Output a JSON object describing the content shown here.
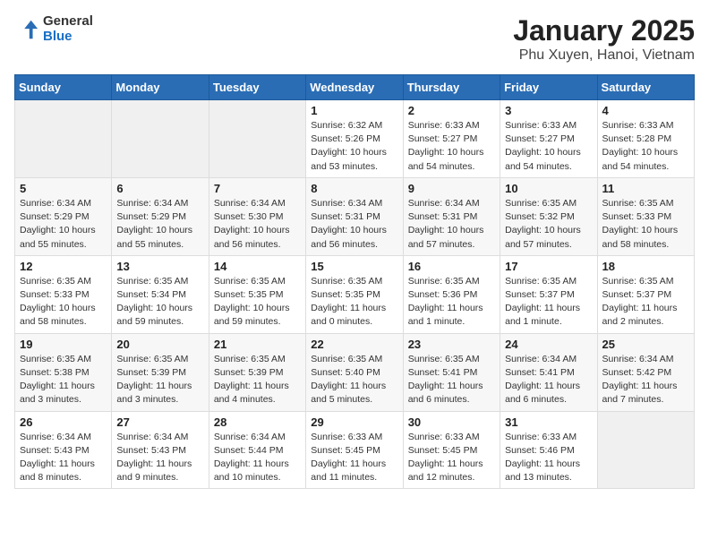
{
  "header": {
    "logo_line1": "General",
    "logo_line2": "Blue",
    "title": "January 2025",
    "subtitle": "Phu Xuyen, Hanoi, Vietnam"
  },
  "days_of_week": [
    "Sunday",
    "Monday",
    "Tuesday",
    "Wednesday",
    "Thursday",
    "Friday",
    "Saturday"
  ],
  "weeks": [
    [
      {
        "day": "",
        "content": ""
      },
      {
        "day": "",
        "content": ""
      },
      {
        "day": "",
        "content": ""
      },
      {
        "day": "1",
        "content": "Sunrise: 6:32 AM\nSunset: 5:26 PM\nDaylight: 10 hours\nand 53 minutes."
      },
      {
        "day": "2",
        "content": "Sunrise: 6:33 AM\nSunset: 5:27 PM\nDaylight: 10 hours\nand 54 minutes."
      },
      {
        "day": "3",
        "content": "Sunrise: 6:33 AM\nSunset: 5:27 PM\nDaylight: 10 hours\nand 54 minutes."
      },
      {
        "day": "4",
        "content": "Sunrise: 6:33 AM\nSunset: 5:28 PM\nDaylight: 10 hours\nand 54 minutes."
      }
    ],
    [
      {
        "day": "5",
        "content": "Sunrise: 6:34 AM\nSunset: 5:29 PM\nDaylight: 10 hours\nand 55 minutes."
      },
      {
        "day": "6",
        "content": "Sunrise: 6:34 AM\nSunset: 5:29 PM\nDaylight: 10 hours\nand 55 minutes."
      },
      {
        "day": "7",
        "content": "Sunrise: 6:34 AM\nSunset: 5:30 PM\nDaylight: 10 hours\nand 56 minutes."
      },
      {
        "day": "8",
        "content": "Sunrise: 6:34 AM\nSunset: 5:31 PM\nDaylight: 10 hours\nand 56 minutes."
      },
      {
        "day": "9",
        "content": "Sunrise: 6:34 AM\nSunset: 5:31 PM\nDaylight: 10 hours\nand 57 minutes."
      },
      {
        "day": "10",
        "content": "Sunrise: 6:35 AM\nSunset: 5:32 PM\nDaylight: 10 hours\nand 57 minutes."
      },
      {
        "day": "11",
        "content": "Sunrise: 6:35 AM\nSunset: 5:33 PM\nDaylight: 10 hours\nand 58 minutes."
      }
    ],
    [
      {
        "day": "12",
        "content": "Sunrise: 6:35 AM\nSunset: 5:33 PM\nDaylight: 10 hours\nand 58 minutes."
      },
      {
        "day": "13",
        "content": "Sunrise: 6:35 AM\nSunset: 5:34 PM\nDaylight: 10 hours\nand 59 minutes."
      },
      {
        "day": "14",
        "content": "Sunrise: 6:35 AM\nSunset: 5:35 PM\nDaylight: 10 hours\nand 59 minutes."
      },
      {
        "day": "15",
        "content": "Sunrise: 6:35 AM\nSunset: 5:35 PM\nDaylight: 11 hours\nand 0 minutes."
      },
      {
        "day": "16",
        "content": "Sunrise: 6:35 AM\nSunset: 5:36 PM\nDaylight: 11 hours\nand 1 minute."
      },
      {
        "day": "17",
        "content": "Sunrise: 6:35 AM\nSunset: 5:37 PM\nDaylight: 11 hours\nand 1 minute."
      },
      {
        "day": "18",
        "content": "Sunrise: 6:35 AM\nSunset: 5:37 PM\nDaylight: 11 hours\nand 2 minutes."
      }
    ],
    [
      {
        "day": "19",
        "content": "Sunrise: 6:35 AM\nSunset: 5:38 PM\nDaylight: 11 hours\nand 3 minutes."
      },
      {
        "day": "20",
        "content": "Sunrise: 6:35 AM\nSunset: 5:39 PM\nDaylight: 11 hours\nand 3 minutes."
      },
      {
        "day": "21",
        "content": "Sunrise: 6:35 AM\nSunset: 5:39 PM\nDaylight: 11 hours\nand 4 minutes."
      },
      {
        "day": "22",
        "content": "Sunrise: 6:35 AM\nSunset: 5:40 PM\nDaylight: 11 hours\nand 5 minutes."
      },
      {
        "day": "23",
        "content": "Sunrise: 6:35 AM\nSunset: 5:41 PM\nDaylight: 11 hours\nand 6 minutes."
      },
      {
        "day": "24",
        "content": "Sunrise: 6:34 AM\nSunset: 5:41 PM\nDaylight: 11 hours\nand 6 minutes."
      },
      {
        "day": "25",
        "content": "Sunrise: 6:34 AM\nSunset: 5:42 PM\nDaylight: 11 hours\nand 7 minutes."
      }
    ],
    [
      {
        "day": "26",
        "content": "Sunrise: 6:34 AM\nSunset: 5:43 PM\nDaylight: 11 hours\nand 8 minutes."
      },
      {
        "day": "27",
        "content": "Sunrise: 6:34 AM\nSunset: 5:43 PM\nDaylight: 11 hours\nand 9 minutes."
      },
      {
        "day": "28",
        "content": "Sunrise: 6:34 AM\nSunset: 5:44 PM\nDaylight: 11 hours\nand 10 minutes."
      },
      {
        "day": "29",
        "content": "Sunrise: 6:33 AM\nSunset: 5:45 PM\nDaylight: 11 hours\nand 11 minutes."
      },
      {
        "day": "30",
        "content": "Sunrise: 6:33 AM\nSunset: 5:45 PM\nDaylight: 11 hours\nand 12 minutes."
      },
      {
        "day": "31",
        "content": "Sunrise: 6:33 AM\nSunset: 5:46 PM\nDaylight: 11 hours\nand 13 minutes."
      },
      {
        "day": "",
        "content": ""
      }
    ]
  ]
}
